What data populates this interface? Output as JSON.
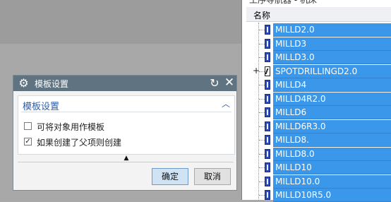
{
  "navigator": {
    "top_title": "工序导航器 - 机床",
    "column_name": "名称",
    "rows": [
      {
        "label": "MILLD2.0",
        "icon": "mill-operation-icon",
        "expandable": false
      },
      {
        "label": "MILLD3",
        "icon": "mill-operation-icon",
        "expandable": false
      },
      {
        "label": "MILLD3.0",
        "icon": "mill-operation-icon",
        "expandable": false
      },
      {
        "label": "SPOTDRILLINGD2.0",
        "icon": "drill-operation-icon",
        "expandable": true,
        "expander": "+"
      },
      {
        "label": "MILLD4",
        "icon": "mill-operation-icon",
        "expandable": false
      },
      {
        "label": "MILLD4R2.0",
        "icon": "mill-operation-icon",
        "expandable": false
      },
      {
        "label": "MILLD6",
        "icon": "mill-operation-icon",
        "expandable": false
      },
      {
        "label": "MILLD6R3.0",
        "icon": "mill-operation-icon",
        "expandable": false
      },
      {
        "label": "MILLD8.",
        "icon": "mill-operation-icon",
        "expandable": false
      },
      {
        "label": "MILLD8.0",
        "icon": "mill-operation-icon",
        "expandable": false
      },
      {
        "label": "MILLD10",
        "icon": "mill-operation-icon",
        "expandable": false
      },
      {
        "label": "MILLD10.0",
        "icon": "mill-operation-icon",
        "expandable": false
      },
      {
        "label": "MILLD10R5.0",
        "icon": "mill-operation-icon",
        "expandable": false
      }
    ],
    "selection_color": "#3a97ea"
  },
  "dialog": {
    "title": "模板设置",
    "title_icon": "gear-icon",
    "reset_icon": "reset-icon",
    "close_icon": "close-icon",
    "group": {
      "title": "模板设置",
      "collapse_icon": "chevron-up-icon",
      "options": [
        {
          "label": "可将对象用作模板",
          "checked": false
        },
        {
          "label": "如果创建了父项则创建",
          "checked": true
        }
      ]
    },
    "more_icon": "triangle-up-icon",
    "buttons": {
      "ok": "确定",
      "cancel": "取消"
    },
    "titlebar_color": "#5f7380"
  }
}
